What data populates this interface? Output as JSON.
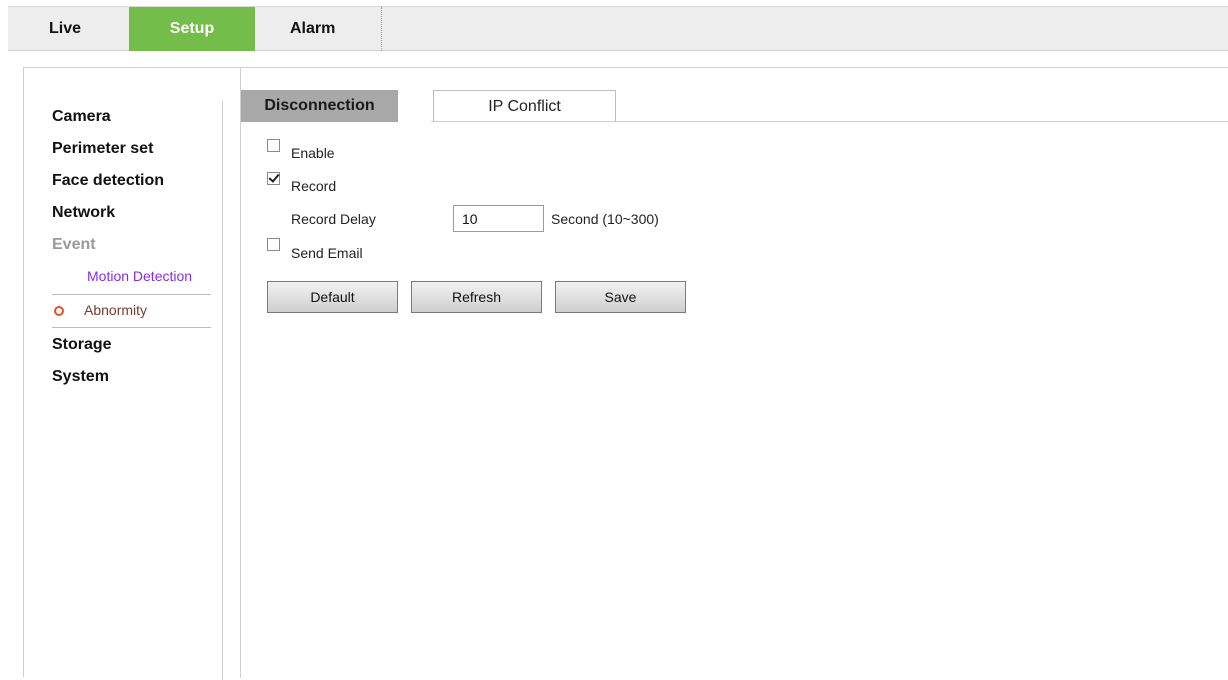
{
  "topnav": {
    "tabs": [
      {
        "label": "Live"
      },
      {
        "label": "Setup"
      },
      {
        "label": "Alarm"
      }
    ],
    "active_color": "#74bd4a"
  },
  "sidebar": {
    "items": [
      {
        "label": "Camera"
      },
      {
        "label": "Perimeter set"
      },
      {
        "label": "Face detection"
      },
      {
        "label": "Network"
      },
      {
        "label": "Event"
      },
      {
        "label": "Storage"
      },
      {
        "label": "System"
      }
    ],
    "event_subitems": [
      {
        "label": "Motion Detection"
      },
      {
        "label": "Abnormity",
        "icon": "bullet-icon"
      }
    ]
  },
  "subtabs": [
    {
      "label": "Disconnection",
      "active": true
    },
    {
      "label": "IP Conflict",
      "active": false
    }
  ],
  "form": {
    "enable_label": "Enable",
    "enable_checked": false,
    "record_label": "Record",
    "record_checked": true,
    "record_delay_label": "Record Delay",
    "record_delay_value": "10",
    "record_delay_unit": "Second (10~300)",
    "send_email_label": "Send Email",
    "send_email_checked": false
  },
  "buttons": {
    "default_label": "Default",
    "refresh_label": "Refresh",
    "save_label": "Save"
  }
}
